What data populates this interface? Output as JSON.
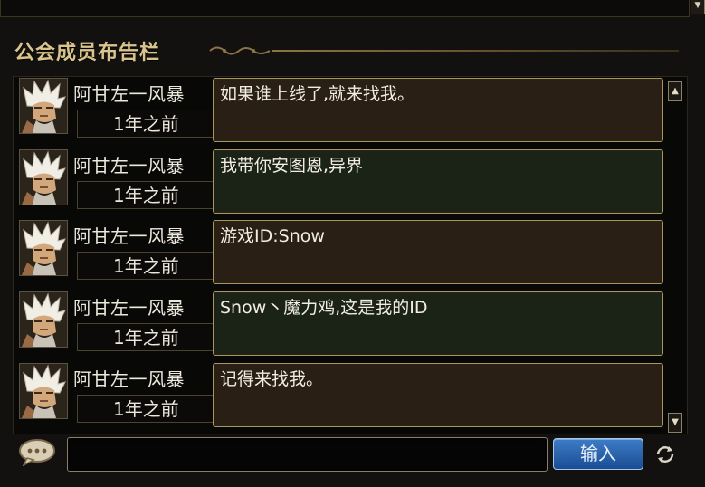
{
  "panel": {
    "title": "公会成员布告栏",
    "input": {
      "value": "",
      "placeholder": ""
    },
    "submit_label": "输入"
  },
  "posts": [
    {
      "author": "阿甘左一风暴",
      "time": "1年之前",
      "message": "如果谁上线了,就来找我。",
      "bubble_color": "#2a1f14"
    },
    {
      "author": "阿甘左一风暴",
      "time": "1年之前",
      "message": "我带你安图恩,异界",
      "bubble_color": "#1b2316"
    },
    {
      "author": "阿甘左一风暴",
      "time": "1年之前",
      "message": "游戏ID:Snow",
      "bubble_color": "#2a1f14"
    },
    {
      "author": "阿甘左一风暴",
      "time": "1年之前",
      "message": "Snow丶魔力鸡,这是我的ID",
      "bubble_color": "#1b2316"
    },
    {
      "author": "阿甘左一风暴",
      "time": "1年之前",
      "message": "记得来找我。",
      "bubble_color": "#2a1f14"
    }
  ],
  "icons": {
    "scroll_up": "scroll-up-icon",
    "scroll_down": "scroll-down-icon",
    "chat": "chat-bubble-icon",
    "refresh": "refresh-icon",
    "avatar": "character-avatar-icon"
  },
  "colors": {
    "background": "#121110",
    "title_gold": "#d9c48c",
    "bubble_border": "#a9955c",
    "submit_blue": "#2b64ad"
  }
}
